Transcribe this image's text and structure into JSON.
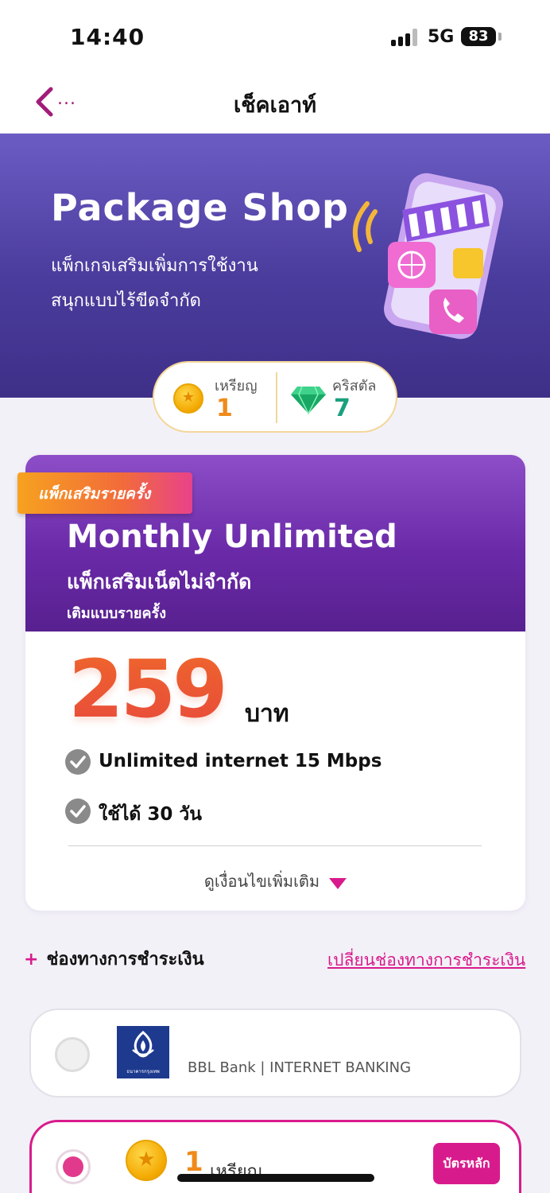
{
  "status": {
    "time": "14:40",
    "network": "5G",
    "battery": "83"
  },
  "nav": {
    "back_dots": "...",
    "title": "เช็คเอาท์"
  },
  "hero": {
    "title": "Package Shop",
    "subtitle_line1": "แพ็กเกจเสริมเพิ่มการใช้งาน",
    "subtitle_line2": "สนุกแบบไร้ขีดจำกัด"
  },
  "rewards": {
    "coin_label": "เหรียญ",
    "coin_value": "1",
    "crystal_label": "คริสตัล",
    "crystal_value": "7"
  },
  "package": {
    "tag": "แพ็กเสริมรายครั้ง",
    "name": "Monthly Unlimited",
    "subtitle": "แพ็กเสริมเน็ตไม่จำกัด",
    "subtitle2": "เติมแบบรายครั้ง",
    "price": "259",
    "currency": "บาท",
    "features": [
      "Unlimited internet 15 Mbps",
      "ใช้ได้ 30 วัน"
    ],
    "more_label": "ดูเงื่อนไขเพิ่มเติม"
  },
  "payment": {
    "header_plus": "+",
    "header": "ช่องทางการชำระเงิน",
    "change_link": "เปลี่ยนช่องทางการชำระเงิน",
    "options": [
      {
        "label": "BBL Bank | INTERNET BANKING",
        "logo_text": "ธนาคารกรุงเทพ",
        "selected": false
      },
      {
        "count": "1",
        "unit": "เหรียญ",
        "badge": "บัตรหลัก",
        "selected": true
      }
    ]
  },
  "colors": {
    "accent": "#d81b8c",
    "hero_bg": "#4a3c9c",
    "price": "#f05a2a"
  },
  "icons": [
    "back-chevron-icon",
    "signal-icon",
    "battery-icon",
    "coin-icon",
    "crystal-icon",
    "check-icon",
    "dropdown-triangle-icon",
    "bank-logo-icon"
  ]
}
